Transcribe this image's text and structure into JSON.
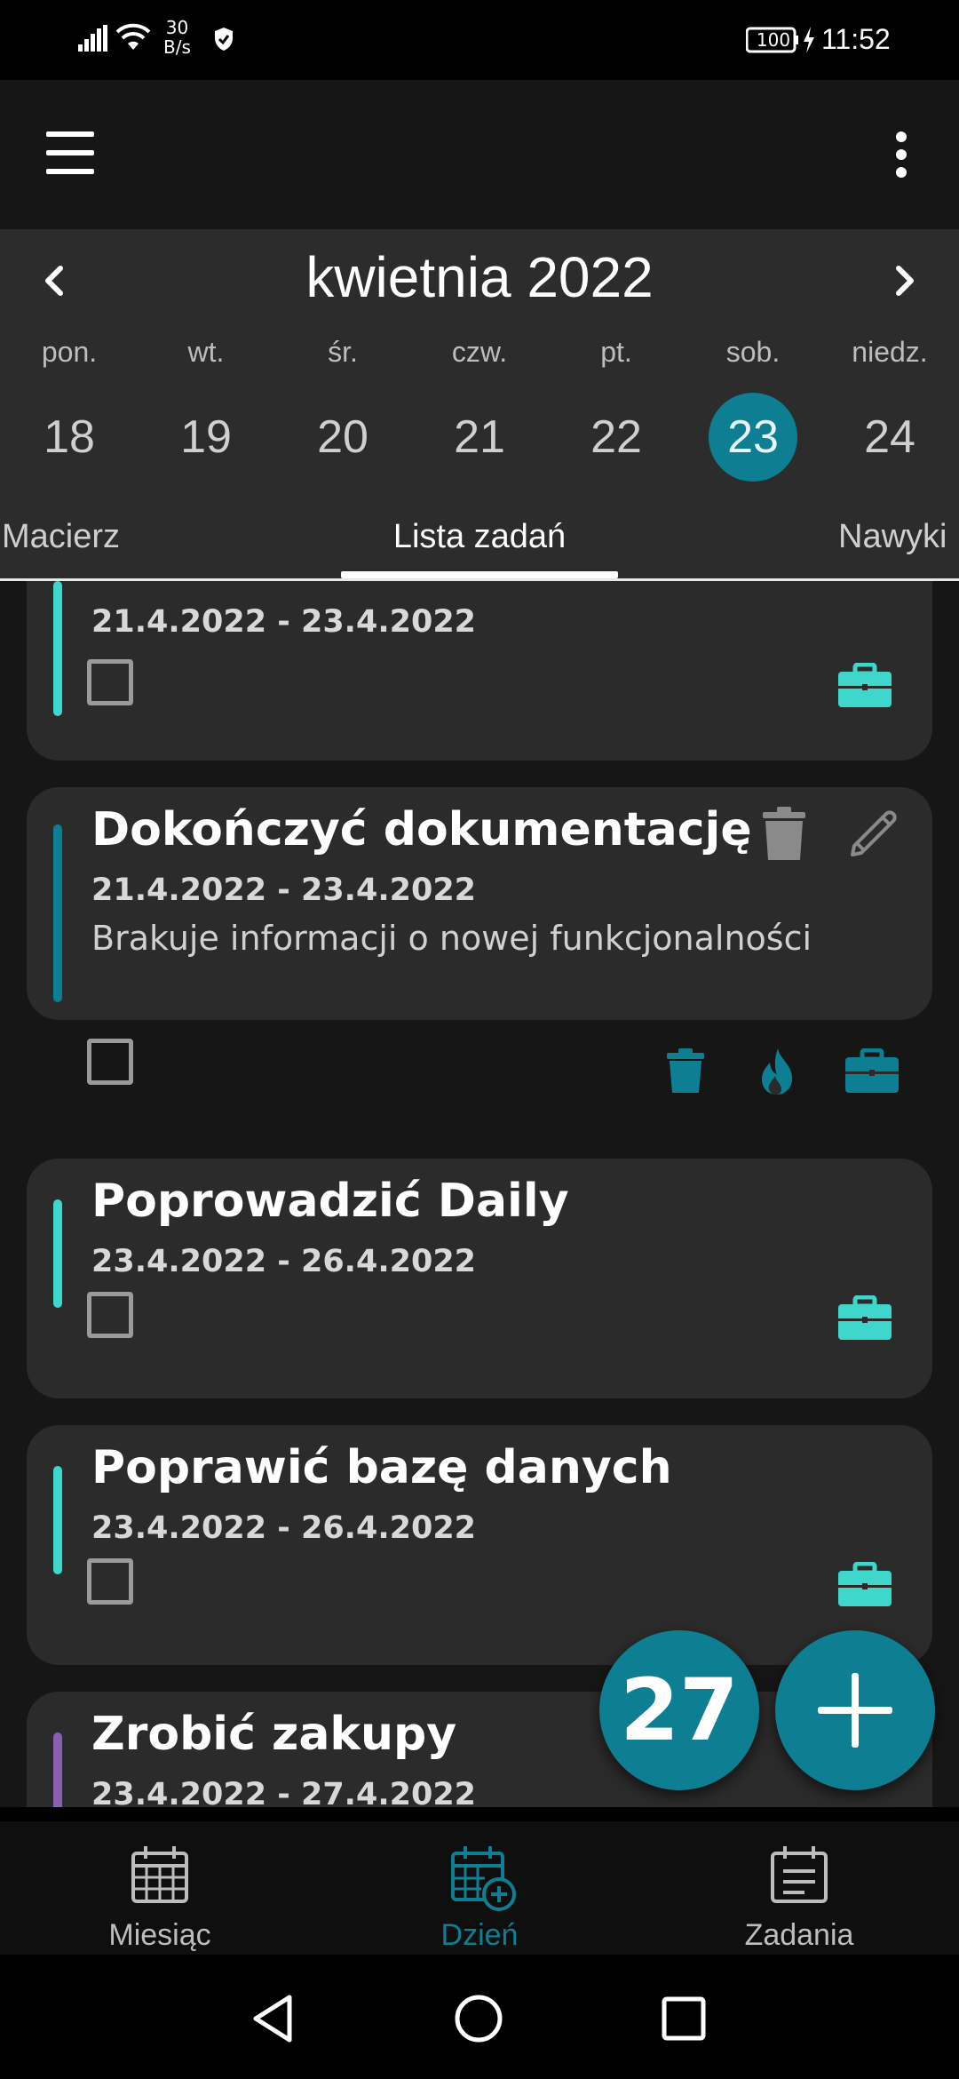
{
  "status_bar": {
    "network_speed_value": "30",
    "network_speed_unit": "B/s",
    "battery": "100",
    "time": "11:52"
  },
  "colors": {
    "accent": "#0e7f92",
    "turquoise": "#3fd7cc",
    "purple": "#8a5fb0",
    "card_bg": "#2b2b2b",
    "header_bg": "#2c2c2c"
  },
  "calendar": {
    "month_label": "kwietnia 2022",
    "days": [
      {
        "name": "pon.",
        "date": "18"
      },
      {
        "name": "wt.",
        "date": "19"
      },
      {
        "name": "śr.",
        "date": "20"
      },
      {
        "name": "czw.",
        "date": "21"
      },
      {
        "name": "pt.",
        "date": "22"
      },
      {
        "name": "sob.",
        "date": "23"
      },
      {
        "name": "niedz.",
        "date": "24"
      }
    ],
    "selected_date": "23"
  },
  "tabs": [
    {
      "label": "Macierz",
      "active": false
    },
    {
      "label": "Lista zadań",
      "active": true
    },
    {
      "label": "Nawyki",
      "active": false
    }
  ],
  "tasks": [
    {
      "title": "",
      "dates": "21.4.2022 - 23.4.2022",
      "description": "",
      "stripe_color": "turquoise",
      "icons": [
        "briefcase-icon"
      ]
    },
    {
      "title": "Dokończyć dokumentację",
      "dates": "21.4.2022 - 23.4.2022",
      "description": "Brakuje informacji o nowej funkcjonalności",
      "stripe_color": "accent",
      "icons": [
        "trash-icon",
        "fire-icon",
        "briefcase-icon"
      ]
    },
    {
      "title": "Poprowadzić Daily",
      "dates": "23.4.2022 - 26.4.2022",
      "description": "",
      "stripe_color": "turquoise",
      "icons": [
        "briefcase-icon"
      ]
    },
    {
      "title": "Poprawić bazę danych",
      "dates": "23.4.2022 - 26.4.2022",
      "description": "",
      "stripe_color": "turquoise",
      "icons": [
        "briefcase-icon"
      ]
    },
    {
      "title": "Zrobić zakupy",
      "dates": "23.4.2022 - 27.4.2022",
      "description": "",
      "stripe_color": "purple",
      "icons": []
    }
  ],
  "fab": {
    "count": "27"
  },
  "bottom_nav": [
    {
      "label": "Miesiąc",
      "icon": "calendar-month-icon",
      "active": false
    },
    {
      "label": "Dzień",
      "icon": "calendar-add-icon",
      "active": true
    },
    {
      "label": "Zadania",
      "icon": "task-list-icon",
      "active": false
    }
  ]
}
